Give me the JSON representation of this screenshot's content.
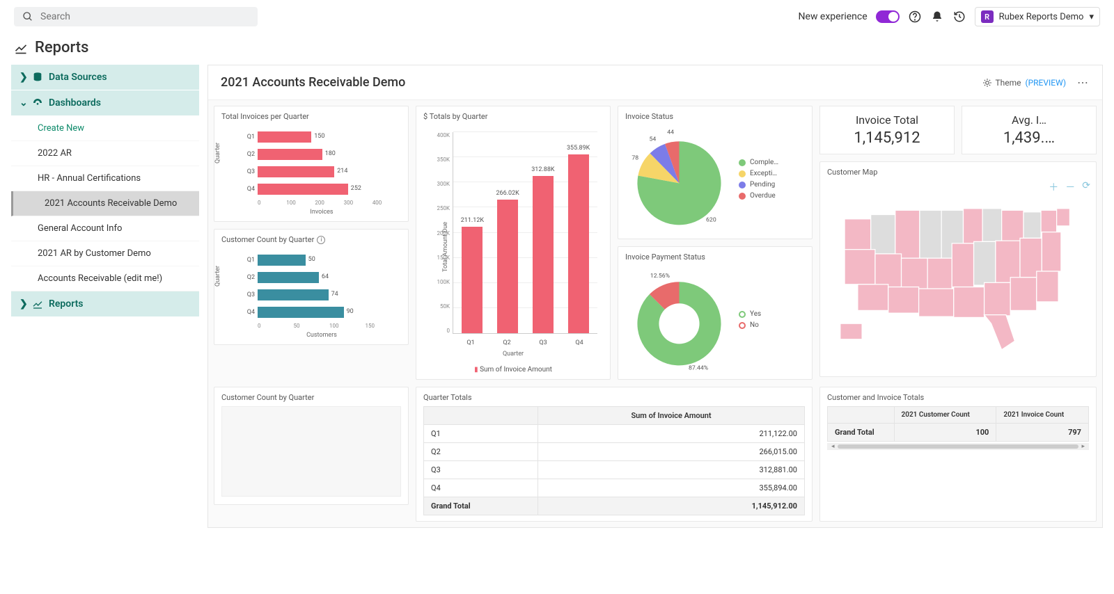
{
  "topbar": {
    "search_placeholder": "Search",
    "new_experience": "New experience",
    "profile_initial": "R",
    "profile_label": "Rubex Reports Demo"
  },
  "page_title": "Reports",
  "sidebar": {
    "data_sources": "Data Sources",
    "dashboards": "Dashboards",
    "reports_nav": "Reports",
    "create_new": "Create New",
    "items": [
      "2022 AR",
      "HR - Annual Certifications",
      "2021 Accounts Receivable Demo",
      "General Account Info",
      "2021 AR by Customer Demo",
      "Accounts Receivable (edit me!)"
    ]
  },
  "dashboard": {
    "title": "2021 Accounts Receivable Demo",
    "theme_label": "Theme",
    "theme_preview": "(PREVIEW)"
  },
  "widgets": {
    "invoices_per_q": {
      "title": "Total Invoices per Quarter",
      "xlabel": "Invoices",
      "ylabel": "Quarter"
    },
    "cust_per_q_chart": {
      "title": "Customer Count by Quarter",
      "xlabel": "Customers",
      "ylabel": "Quarter"
    },
    "totals_by_q": {
      "title": "$ Totals by Quarter",
      "xlabel": "Quarter",
      "ylabel": "Total Amount Due",
      "footer": "Sum of Invoice Amount"
    },
    "invoice_status": {
      "title": "Invoice Status"
    },
    "payment_status": {
      "title": "Invoice Payment Status"
    },
    "invoice_total": {
      "title": "Invoice Total",
      "value": "1,145,912"
    },
    "avg_invoice": {
      "title": "Avg. I…",
      "value": "1,439.…"
    },
    "customer_map": {
      "title": "Customer Map"
    },
    "cust_per_q_table": {
      "title": "Customer Count by Quarter"
    },
    "quarter_totals": {
      "title": "Quarter Totals",
      "col1": "",
      "col2": "Sum of Invoice Amount",
      "grand": "Grand Total",
      "grand_val": "1,145,912.00"
    },
    "cust_inv_totals": {
      "title": "Customer and Invoice Totals",
      "col1": "2021 Customer Count",
      "col2": "2021 Invoice Count",
      "grand": "Grand Total",
      "v1": "100",
      "v2": "797"
    }
  },
  "chart_data": [
    {
      "id": "invoices_per_quarter",
      "type": "bar",
      "orientation": "horizontal",
      "title": "Total Invoices per Quarter",
      "xlabel": "Invoices",
      "ylabel": "Quarter",
      "categories": [
        "Q1",
        "Q2",
        "Q3",
        "Q4"
      ],
      "values": [
        150,
        180,
        214,
        252
      ],
      "xlim": [
        0,
        400
      ],
      "xticks": [
        0,
        100,
        200,
        300,
        400
      ],
      "color": "#f06272"
    },
    {
      "id": "customer_count_quarter",
      "type": "bar",
      "orientation": "horizontal",
      "title": "Customer Count by Quarter",
      "xlabel": "Customers",
      "ylabel": "Quarter",
      "categories": [
        "Q1",
        "Q2",
        "Q3",
        "Q4"
      ],
      "values": [
        50,
        64,
        74,
        90
      ],
      "xlim": [
        0,
        150
      ],
      "xticks": [
        0,
        50,
        100,
        150
      ],
      "color": "#3a8ea0"
    },
    {
      "id": "totals_by_quarter",
      "type": "bar",
      "orientation": "vertical",
      "title": "$ Totals by Quarter",
      "xlabel": "Quarter",
      "ylabel": "Total Amount Due",
      "categories": [
        "Q1",
        "Q2",
        "Q3",
        "Q4"
      ],
      "values": [
        211120,
        266020,
        312880,
        355890
      ],
      "value_labels": [
        "211.12K",
        "266.02K",
        "312.88K",
        "355.89K"
      ],
      "ylim": [
        0,
        400000
      ],
      "yticks": [
        "400K",
        "350K",
        "300K",
        "250K",
        "200K",
        "150K",
        "100K",
        "50K",
        "0"
      ],
      "color": "#f06272",
      "legend": "Sum of Invoice Amount"
    },
    {
      "id": "invoice_status",
      "type": "pie",
      "title": "Invoice Status",
      "series": [
        {
          "name": "Comple…",
          "value": 620,
          "color": "#7ec97a"
        },
        {
          "name": "Excepti…",
          "value": 78,
          "color": "#f6d568"
        },
        {
          "name": "Pending",
          "value": 54,
          "color": "#7c7ce8"
        },
        {
          "name": "Overdue",
          "value": 44,
          "color": "#e86b6b"
        }
      ]
    },
    {
      "id": "invoice_payment_status",
      "type": "pie",
      "subtype": "donut",
      "title": "Invoice Payment Status",
      "series": [
        {
          "name": "Yes",
          "value": 87.44,
          "label": "87.44%",
          "color": "#7ec97a"
        },
        {
          "name": "No",
          "value": 12.56,
          "label": "12.56%",
          "color": "#e86b6b"
        }
      ]
    },
    {
      "id": "quarter_totals_table",
      "type": "table",
      "title": "Quarter Totals",
      "columns": [
        "",
        "Sum of Invoice Amount"
      ],
      "rows": [
        [
          "Q1",
          "211,122.00"
        ],
        [
          "Q2",
          "266,015.00"
        ],
        [
          "Q3",
          "312,881.00"
        ],
        [
          "Q4",
          "355,894.00"
        ]
      ],
      "total_row": [
        "Grand Total",
        "1,145,912.00"
      ]
    },
    {
      "id": "customer_invoice_totals",
      "type": "table",
      "title": "Customer and Invoice Totals",
      "columns": [
        "",
        "2021 Customer Count",
        "2021 Invoice Count"
      ],
      "rows": [
        [
          "Grand Total",
          "100",
          "797"
        ]
      ]
    }
  ]
}
